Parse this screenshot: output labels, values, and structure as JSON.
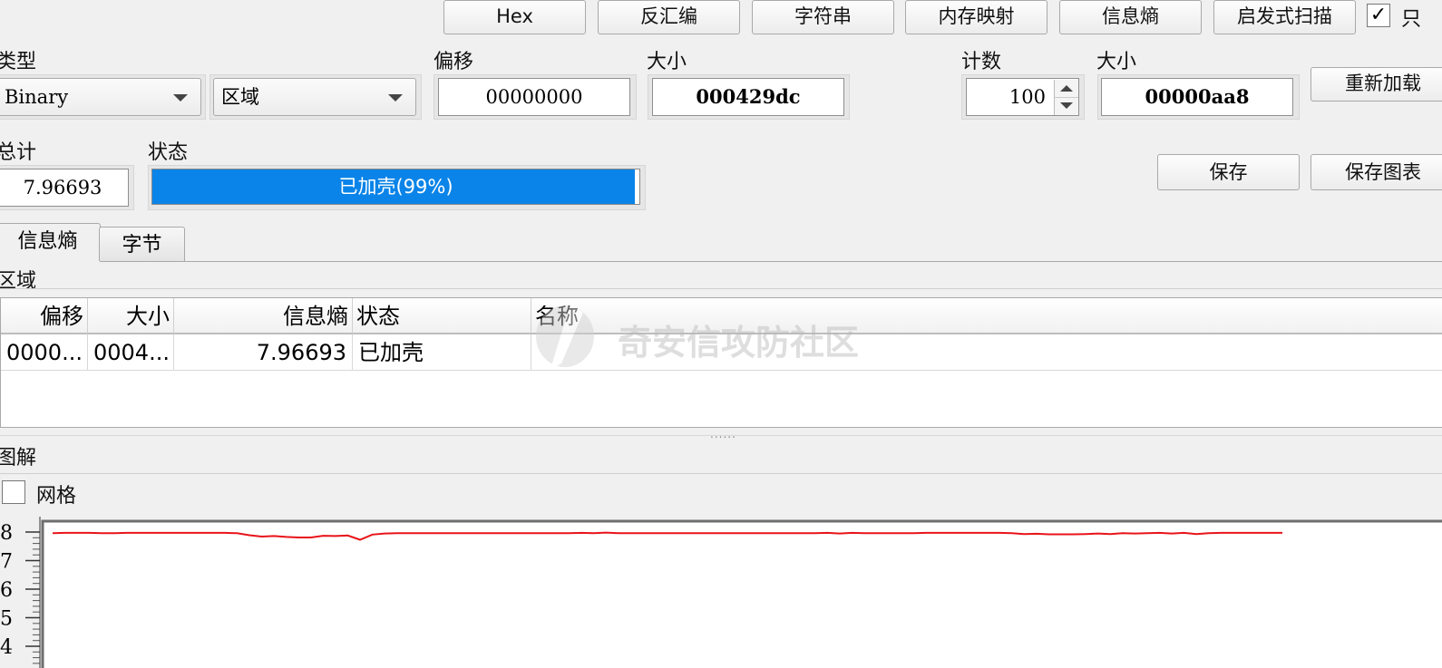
{
  "toolbar": {
    "buttons": [
      "Hex",
      "反汇编",
      "字符串",
      "内存映射",
      "信息熵",
      "启发式扫描"
    ],
    "readonly_checkbox": {
      "checked": true,
      "label": "只"
    }
  },
  "fields": {
    "type_label": "类型",
    "type_value": "Binary",
    "region_value": "区域",
    "offset_label": "偏移",
    "offset_value": "00000000",
    "size_label": "大小",
    "size_value": "000429dc",
    "count_label": "计数",
    "count_value": "100",
    "size2_label": "大小",
    "size2_value": "00000aa8",
    "reload_button": "重新加载",
    "total_label": "总计",
    "total_value": "7.96693",
    "status_label": "状态",
    "status_value": "已加壳(99%)",
    "status_progress_percent": 99,
    "save_button": "保存",
    "save_chart_button": "保存图表"
  },
  "tabs": [
    "信息熵",
    "字节"
  ],
  "regions": {
    "title": "区域",
    "columns": [
      "偏移",
      "大小",
      "信息熵",
      "状态",
      "名称"
    ],
    "rows": [
      {
        "offset": "0000...",
        "size": "0004...",
        "entropy": "7.96693",
        "status": "已加壳",
        "name": ""
      }
    ]
  },
  "watermark": "奇安信攻防社区",
  "splitter": "......",
  "legend": {
    "title": "图解",
    "grid_label": "网格",
    "grid_checked": false
  },
  "colors": {
    "progress": "#0a84e8",
    "line": "#e8141a"
  },
  "chart_data": {
    "type": "line",
    "title": "",
    "xlabel": "",
    "ylabel": "",
    "yticks": [
      "8",
      "7",
      "6",
      "5",
      "4"
    ],
    "ylim": [
      3.6,
      8.2
    ],
    "grid": false,
    "series": [
      {
        "values": [
          7.96,
          7.97,
          7.97,
          7.97,
          7.96,
          7.96,
          7.97,
          7.97,
          7.97,
          7.97,
          7.97,
          7.97,
          7.97,
          7.97,
          7.97,
          7.96,
          7.89,
          7.84,
          7.86,
          7.83,
          7.81,
          7.81,
          7.87,
          7.86,
          7.88,
          7.73,
          7.91,
          7.95,
          7.96,
          7.96,
          7.96,
          7.96,
          7.96,
          7.96,
          7.96,
          7.96,
          7.96,
          7.96,
          7.96,
          7.96,
          7.96,
          7.96,
          7.96,
          7.97,
          7.96,
          7.98,
          7.96,
          7.96,
          7.96,
          7.96,
          7.96,
          7.96,
          7.96,
          7.96,
          7.96,
          7.96,
          7.96,
          7.96,
          7.96,
          7.96,
          7.96,
          7.96,
          7.96,
          7.97,
          7.95,
          7.97,
          7.96,
          7.96,
          7.96,
          7.96,
          7.96,
          7.97,
          7.97,
          7.97,
          7.97,
          7.97,
          7.97,
          7.97,
          7.96,
          7.93,
          7.94,
          7.92,
          7.92,
          7.92,
          7.93,
          7.95,
          7.93,
          7.96,
          7.95,
          7.96,
          7.97,
          7.95,
          7.97,
          7.93,
          7.96,
          7.97,
          7.97,
          7.97,
          7.97,
          7.97,
          7.97
        ]
      }
    ]
  }
}
